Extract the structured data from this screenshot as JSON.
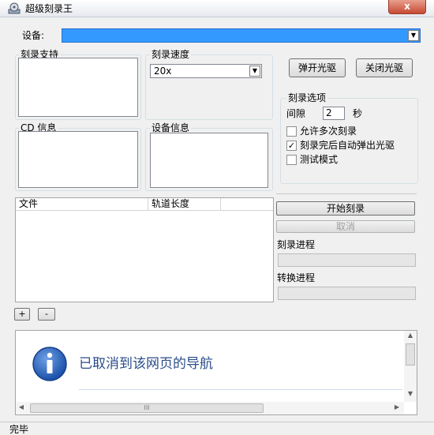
{
  "window": {
    "title": "超级刻录王",
    "close_symbol": "x",
    "app_icon": "app-icon"
  },
  "device": {
    "label": "设备:",
    "selected": ""
  },
  "groups": {
    "burn_support": "刻录支持",
    "burn_speed": "刻录速度",
    "cd_info": "CD 信息",
    "device_info": "设备信息",
    "burn_options": "刻录选项"
  },
  "speed": {
    "selected": "20x"
  },
  "buttons": {
    "eject": "弹开光驱",
    "close_drive": "关闭光驱",
    "start_burn": "开始刻录",
    "stop": "取消",
    "add": "+",
    "remove": "-"
  },
  "options": {
    "interval_label": "间隙",
    "interval_value": "2",
    "interval_unit": "秒",
    "multi_session": {
      "label": "允许多次刻录",
      "checked": false
    },
    "auto_eject": {
      "label": "刻录完后自动弹出光驱",
      "checked": true
    },
    "test_mode": {
      "label": "测试模式",
      "checked": false
    }
  },
  "file_list": {
    "columns": [
      "文件",
      "轨道长度",
      ""
    ]
  },
  "progress": {
    "burn_label": "刻录进程",
    "convert_label": "转换进程",
    "burn_value": 0,
    "convert_value": 0
  },
  "browser": {
    "message": "已取消到该网页的导航",
    "info_icon": "info-icon",
    "scroll_thumb_symbol": "III"
  },
  "status": {
    "text": "完毕"
  },
  "colors": {
    "accent": "#3399ff",
    "info_blue": "#1f5fb8",
    "message_text": "#2a4d8a"
  }
}
